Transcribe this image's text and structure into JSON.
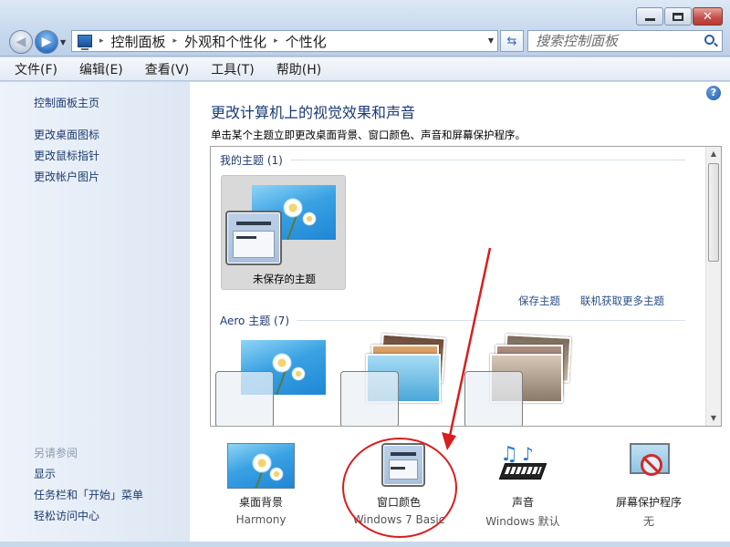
{
  "window": {
    "minimize_glyph": "minimize-icon",
    "maximize_glyph": "maximize-icon",
    "close_glyph": "✕"
  },
  "address": {
    "crumbs": [
      "控制面板",
      "外观和个性化",
      "个性化"
    ],
    "separator": "▸",
    "search_placeholder": "搜索控制面板"
  },
  "menu": {
    "items": [
      "文件(F)",
      "编辑(E)",
      "查看(V)",
      "工具(T)",
      "帮助(H)"
    ]
  },
  "left": {
    "home": "控制面板主页",
    "links": [
      "更改桌面图标",
      "更改鼠标指针",
      "更改帐户图片"
    ],
    "see_also_title": "另请参阅",
    "see_also": [
      "显示",
      "任务栏和「开始」菜单",
      "轻松访问中心"
    ]
  },
  "main": {
    "title": "更改计算机上的视觉效果和声音",
    "subtitle": "单击某个主题立即更改桌面背景、窗口颜色、声音和屏幕保护程序。",
    "my_themes_header": "我的主题 (1)",
    "unsaved_theme_label": "未保存的主题",
    "save_theme": "保存主题",
    "get_more": "联机获取更多主题",
    "aero_header": "Aero 主题 (7)",
    "help": "?"
  },
  "settings": [
    {
      "label": "桌面背景",
      "value": "Harmony",
      "icon": "desktop-background-icon"
    },
    {
      "label": "窗口颜色",
      "value": "Windows 7 Basic",
      "icon": "window-color-icon"
    },
    {
      "label": "声音",
      "value": "Windows 默认",
      "icon": "sound-icon"
    },
    {
      "label": "屏幕保护程序",
      "value": "无",
      "icon": "screensaver-icon"
    }
  ],
  "colors": {
    "annotation_red": "#d81e1e",
    "link_blue": "#1e3b6f",
    "title_blue": "#1a3b73"
  }
}
